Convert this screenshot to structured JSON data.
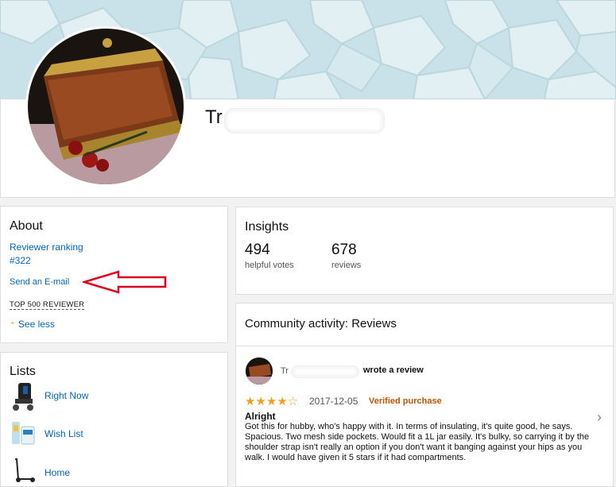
{
  "profile": {
    "name_prefix": "Tr"
  },
  "about": {
    "title": "About",
    "ranking_label": "Reviewer ranking",
    "ranking_value": "#322",
    "email_link": "Send an E-mail",
    "badge": "TOP 500 REVIEWER",
    "see_less": "See less"
  },
  "lists": {
    "title": "Lists",
    "items": [
      {
        "label": "Right Now",
        "icon": "stroller-thumbnail-icon"
      },
      {
        "label": "Wish List",
        "icon": "product-thumbnail-icon"
      },
      {
        "label": "Home",
        "icon": "scooter-thumbnail-icon"
      }
    ]
  },
  "insights": {
    "title": "Insights",
    "stats": [
      {
        "value": "494",
        "label": "helpful votes"
      },
      {
        "value": "678",
        "label": "reviews"
      }
    ]
  },
  "community": {
    "title": "Community activity: Reviews",
    "review": {
      "author_prefix": "Tr",
      "action": "wrote a review",
      "rating": 4,
      "stars_text": "★★★★☆",
      "date": "2017-12-05",
      "verified": "Verified purchase",
      "title": "Alright",
      "body_1": "Got this for hubby, who's happy with it. In terms of insulating, it's quite good, he says.",
      "body_2": "Spacious. Two mesh side pockets. Would fit a 1L jar easily. It's bulky, so carrying it by the shoulder strap isn't really an option if you don't want it banging against your hips as you walk. I would have given it 5 stars if it had compartments."
    }
  },
  "colors": {
    "link": "#0066c0",
    "verified": "#c45500",
    "star": "#f0a020",
    "arrow": "#e0001b"
  }
}
